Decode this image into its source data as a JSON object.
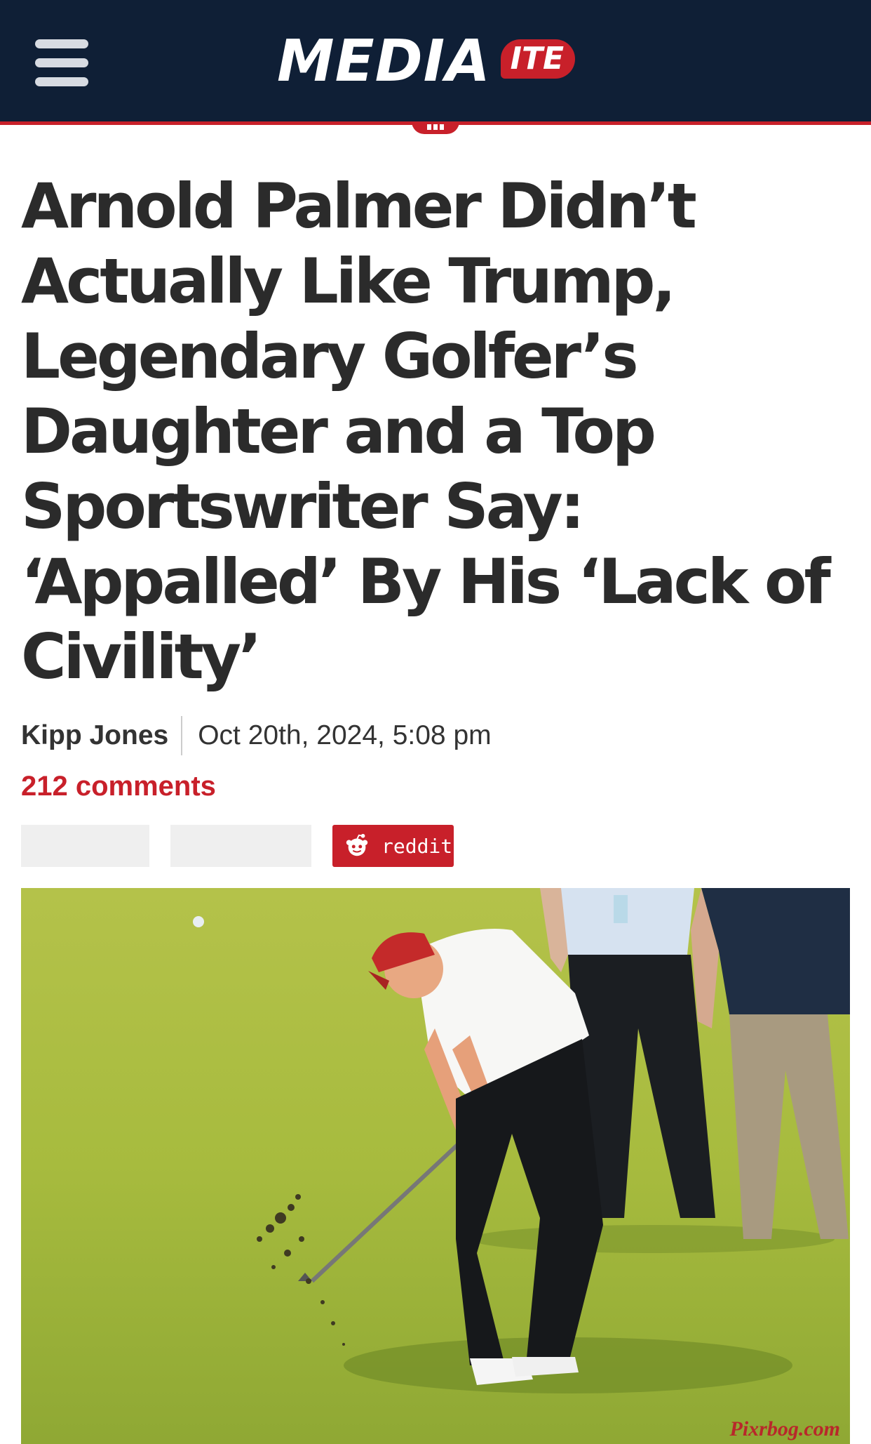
{
  "header": {
    "logo_main": "MEDIA",
    "logo_badge": "ITE",
    "menu_icon": "hamburger-icon",
    "background_color": "#0f1f36",
    "accent_color": "#c8202a"
  },
  "article": {
    "headline": "Arnold Palmer Didn’t Actually Like Trump, Legendary Golfer’s Daughter and a Top Sportswriter Say: ‘Appalled’ By His ‘Lack of Civility’",
    "author": "Kipp Jones",
    "date": "Oct 20th, 2024, 5:08 pm",
    "comments": "212 comments"
  },
  "share": {
    "reddit_label": "reddit",
    "reddit_icon": "reddit-alien-icon"
  },
  "photo": {
    "watermark": "Pixrbog.com"
  }
}
